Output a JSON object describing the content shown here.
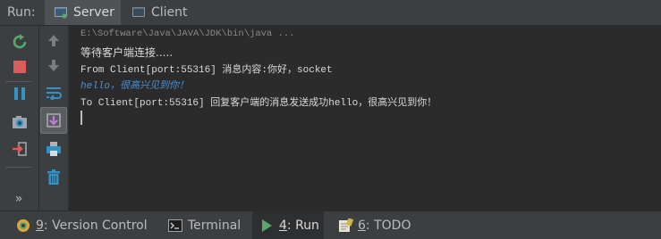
{
  "run_panel": {
    "label": "Run:",
    "tabs": [
      {
        "label": "Server",
        "active": true
      },
      {
        "label": "Client",
        "active": false
      }
    ]
  },
  "console": {
    "command_line": "E:\\Software\\Java\\JAVA\\JDK\\bin\\java ...",
    "lines": [
      "等待客户端连接.....",
      "From Client[port:55316] 消息内容:你好，socket",
      "hello，很高兴见到你！",
      "To Client[port:55316] 回复客户端的消息发送成功hello，很高兴见到你！"
    ]
  },
  "bottom_tabs": [
    {
      "number": "9",
      "label": ": Version Control",
      "icon": "version-control-icon"
    },
    {
      "number": "",
      "label": "Terminal",
      "icon": "terminal-icon"
    },
    {
      "number": "4",
      "label": ": Run",
      "icon": "run-icon",
      "active": true
    },
    {
      "number": "6",
      "label": ": TODO",
      "icon": "todo-icon"
    }
  ],
  "toolbar": {
    "more": "»"
  },
  "colors": {
    "background": "#2b2b2b",
    "panel": "#3c3f41",
    "accent_green": "#59a869",
    "accent_red": "#db5c5c",
    "accent_blue": "#3592c4"
  }
}
